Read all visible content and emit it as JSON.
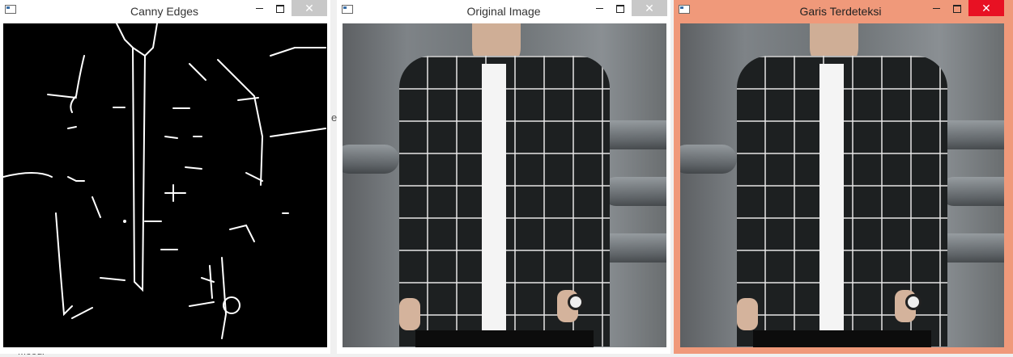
{
  "windows": [
    {
      "id": "canny",
      "title": "Canny Edges"
    },
    {
      "id": "original",
      "title": "Original Image"
    },
    {
      "id": "detected",
      "title": "Garis Terdeteksi"
    }
  ],
  "controls": {
    "minimize": "minimize",
    "maximize": "maximize",
    "close": "✕"
  },
  "colors": {
    "active_frame": "#f0997a",
    "inactive_frame": "#ffffff",
    "edge_bg": "#000000",
    "edge_line": "#ffffff",
    "close_inactive": "#c8c8c8",
    "close_active": "#e81123"
  },
  "icons": [
    "app-window-icon",
    "minimize-icon",
    "maximize-icon",
    "close-icon"
  ],
  "background_glyphs": {
    "left_edge_char": "e",
    "bottom_text": "Moodl"
  }
}
